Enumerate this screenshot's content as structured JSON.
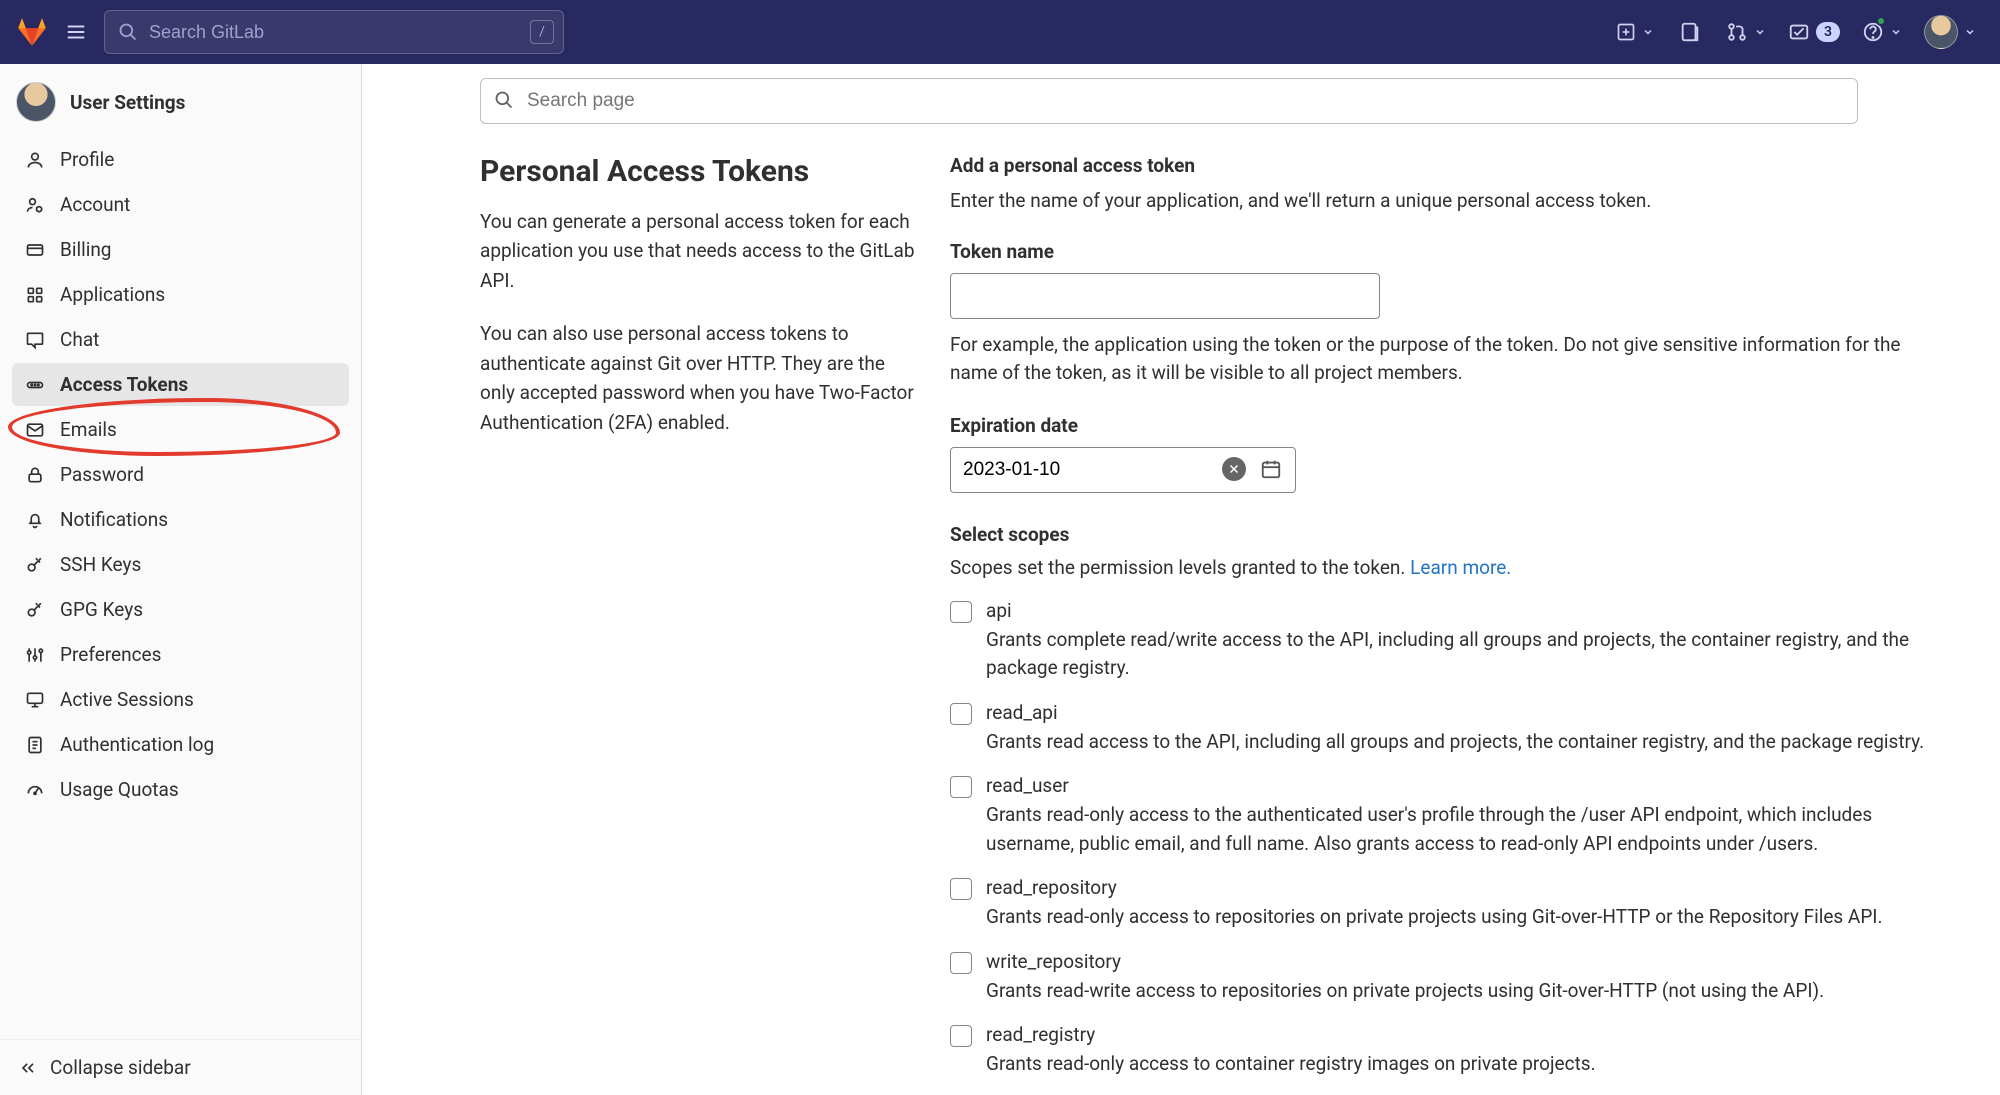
{
  "topnav": {
    "search_placeholder": "Search GitLab",
    "todo_count": "3"
  },
  "sidebar": {
    "title": "User Settings",
    "items": [
      {
        "label": "Profile",
        "icon": "user-icon"
      },
      {
        "label": "Account",
        "icon": "gear-user-icon"
      },
      {
        "label": "Billing",
        "icon": "card-icon"
      },
      {
        "label": "Applications",
        "icon": "apps-icon"
      },
      {
        "label": "Chat",
        "icon": "chat-icon"
      },
      {
        "label": "Access Tokens",
        "icon": "ellipsis-icon"
      },
      {
        "label": "Emails",
        "icon": "mail-icon"
      },
      {
        "label": "Password",
        "icon": "lock-icon"
      },
      {
        "label": "Notifications",
        "icon": "bell-icon"
      },
      {
        "label": "SSH Keys",
        "icon": "key-icon"
      },
      {
        "label": "GPG Keys",
        "icon": "key-icon"
      },
      {
        "label": "Preferences",
        "icon": "sliders-icon"
      },
      {
        "label": "Active Sessions",
        "icon": "monitor-icon"
      },
      {
        "label": "Authentication log",
        "icon": "log-icon"
      },
      {
        "label": "Usage Quotas",
        "icon": "gauge-icon"
      }
    ],
    "active_index": 5,
    "collapse_label": "Collapse sidebar"
  },
  "page": {
    "search_placeholder": "Search page",
    "title": "Personal Access Tokens",
    "lead1": "You can generate a personal access token for each application you use that needs access to the GitLab API.",
    "lead2": "You can also use personal access tokens to authenticate against Git over HTTP. They are the only accepted password when you have Two-Factor Authentication (2FA) enabled.",
    "form_heading": "Add a personal access token",
    "form_sub": "Enter the name of your application, and we'll return a unique personal access token.",
    "token_name_label": "Token name",
    "token_name_value": "",
    "token_name_helper": "For example, the application using the token or the purpose of the token. Do not give sensitive information for the name of the token, as it will be visible to all project members.",
    "expiration_label": "Expiration date",
    "expiration_value": "2023-01-10",
    "scopes_heading": "Select scopes",
    "scopes_intro_text": "Scopes set the permission levels granted to the token. ",
    "scopes_learn_more": "Learn more.",
    "scopes": [
      {
        "name": "api",
        "desc": "Grants complete read/write access to the API, including all groups and projects, the container registry, and the package registry."
      },
      {
        "name": "read_api",
        "desc": "Grants read access to the API, including all groups and projects, the container registry, and the package registry."
      },
      {
        "name": "read_user",
        "desc": "Grants read-only access to the authenticated user's profile through the /user API endpoint, which includes username, public email, and full name. Also grants access to read-only API endpoints under /users."
      },
      {
        "name": "read_repository",
        "desc": "Grants read-only access to repositories on private projects using Git-over-HTTP or the Repository Files API."
      },
      {
        "name": "write_repository",
        "desc": "Grants read-write access to repositories on private projects using Git-over-HTTP (not using the API)."
      },
      {
        "name": "read_registry",
        "desc": "Grants read-only access to container registry images on private projects."
      }
    ]
  }
}
